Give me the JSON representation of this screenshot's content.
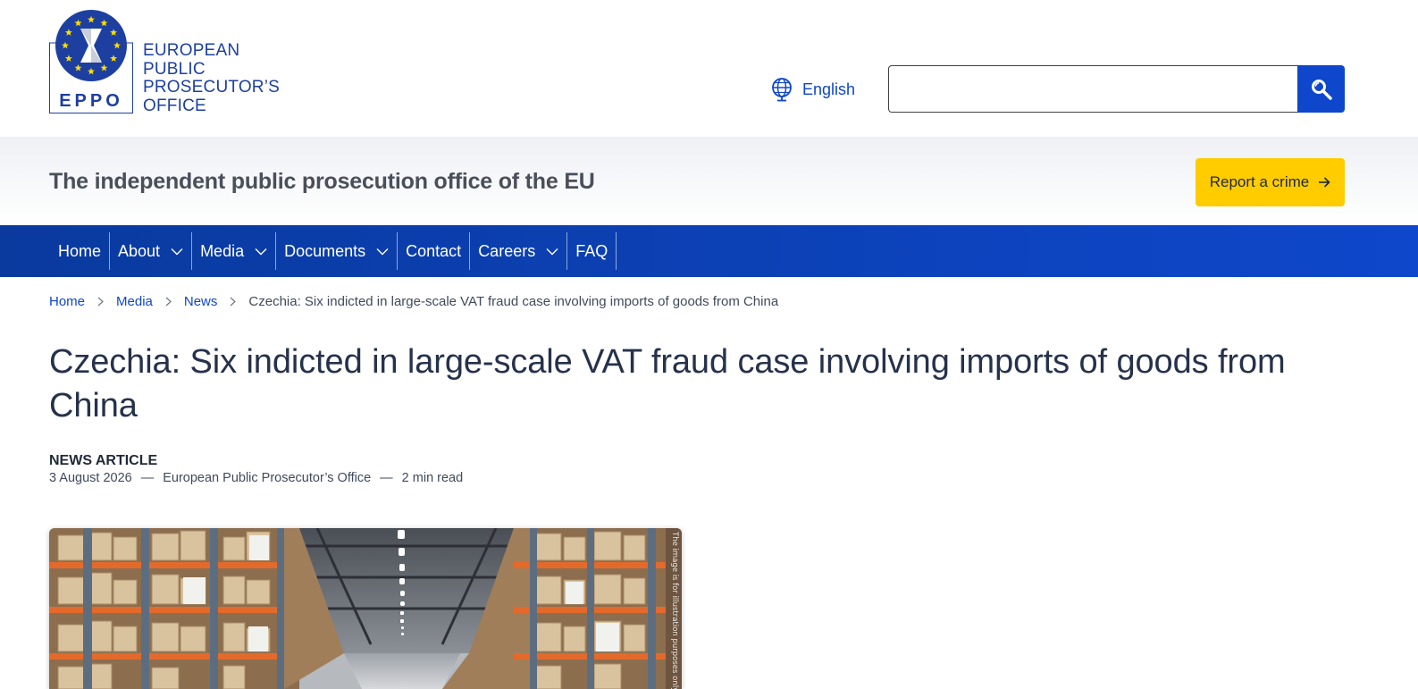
{
  "header": {
    "logo": {
      "acronym": "EPPO",
      "name_lines": [
        "EUROPEAN",
        "PUBLIC",
        "PROSECUTOR’S",
        "OFFICE"
      ],
      "brand_color": "#1d3fa0",
      "star_color": "#ffdd00"
    },
    "language": {
      "label": "English",
      "icon": "globe-icon"
    },
    "search": {
      "value": "",
      "placeholder": "",
      "icon": "search-icon",
      "button_color": "#0e47cb"
    }
  },
  "tagline": {
    "text": "The independent public prosecution office of the EU",
    "report_button": {
      "label": "Report a crime",
      "icon": "arrow-right-icon",
      "color": "#ffcc00"
    }
  },
  "nav": {
    "color": "#0e47cb",
    "items": [
      {
        "label": "Home",
        "dropdown": false
      },
      {
        "label": "About",
        "dropdown": true
      },
      {
        "label": "Media",
        "dropdown": true
      },
      {
        "label": "Documents",
        "dropdown": true
      },
      {
        "label": "Contact",
        "dropdown": false
      },
      {
        "label": "Careers",
        "dropdown": true
      },
      {
        "label": "FAQ",
        "dropdown": false
      }
    ]
  },
  "breadcrumb": {
    "items": [
      "Home",
      "Media",
      "News"
    ],
    "current": "Czechia: Six indicted in large-scale VAT fraud case involving imports of goods from China"
  },
  "article": {
    "title": "Czechia: Six indicted in large-scale VAT fraud case involving imports of goods from China",
    "type": "NEWS ARTICLE",
    "date": "3 August 2026",
    "author": "European Public Prosecutor’s Office",
    "separator": "—",
    "read_time": "2 min read",
    "image_caption": "The image is for illustration purposes only"
  }
}
